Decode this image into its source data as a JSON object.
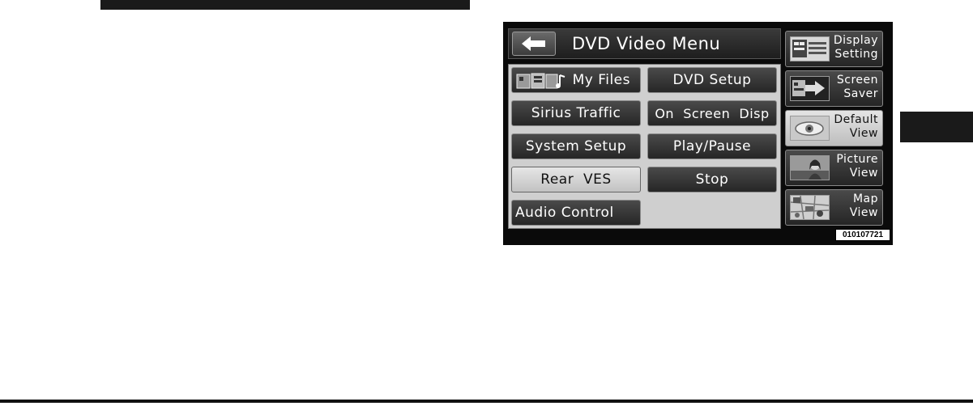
{
  "screen": {
    "title": "DVD Video Menu",
    "back_icon": "left-arrow-icon",
    "figure_code": "010107721"
  },
  "menu": {
    "left": [
      {
        "label": "My Files",
        "icon": "my-files-icon",
        "active": false
      },
      {
        "label": "Sirius Traffic",
        "active": false
      },
      {
        "label": "System Setup",
        "active": false
      },
      {
        "label": "Rear  VES",
        "active": true
      },
      {
        "label": "Audio Control",
        "active": false
      }
    ],
    "right": [
      {
        "label": "DVD Setup",
        "active": false
      },
      {
        "label": "On  Screen  Disp",
        "active": false
      },
      {
        "label": "Play/Pause",
        "active": false
      },
      {
        "label": "Stop",
        "active": false
      }
    ]
  },
  "side": [
    {
      "line1": "Display",
      "line2": "Setting",
      "icon": "display-setting-icon",
      "active": false
    },
    {
      "line1": "Screen",
      "line2": "Saver",
      "icon": "screen-saver-icon",
      "active": false
    },
    {
      "line1": "Default",
      "line2": "View",
      "icon": "default-view-icon",
      "active": true
    },
    {
      "line1": "Picture",
      "line2": "View",
      "icon": "picture-view-icon",
      "active": false
    },
    {
      "line1": "Map",
      "line2": "View",
      "icon": "map-view-icon",
      "active": false
    }
  ]
}
